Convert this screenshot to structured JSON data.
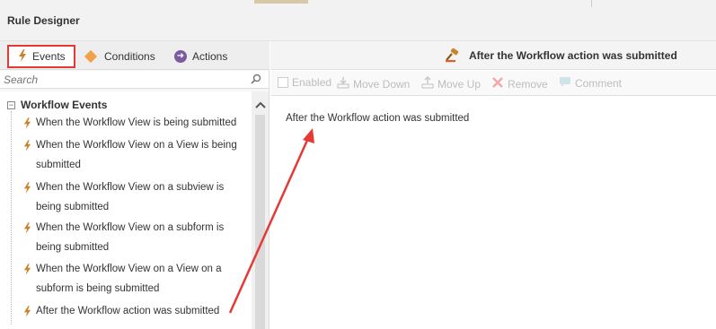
{
  "window": {
    "title": "Rule Designer"
  },
  "tabs": [
    {
      "label": "Events",
      "icon": "lightning-icon"
    },
    {
      "label": "Conditions",
      "icon": "diamond-icon"
    },
    {
      "label": "Actions",
      "icon": "arrow-circle-icon"
    }
  ],
  "search": {
    "placeholder": "Search"
  },
  "tree": {
    "group_label": "Workflow Events",
    "items": [
      {
        "line1": "When the Workflow View is being submitted",
        "line2": ""
      },
      {
        "line1": "When the Workflow View on a View is being",
        "line2": "submitted"
      },
      {
        "line1": "When the Workflow View on a subview is",
        "line2": "being submitted"
      },
      {
        "line1": "When the Workflow View on a subform is",
        "line2": "being submitted"
      },
      {
        "line1": "When the Workflow View on a View on a",
        "line2": "subform is being submitted"
      },
      {
        "line1": "After the Workflow action was submitted",
        "line2": ""
      }
    ]
  },
  "right_header": {
    "title": "After the Workflow action was submitted",
    "icon": "gavel-icon"
  },
  "toolbar": {
    "enabled_label": "Enabled",
    "move_down_label": "Move Down",
    "move_up_label": "Move Up",
    "remove_label": "Remove",
    "comment_label": "Comment"
  },
  "rule_text": "After the Workflow action was submitted",
  "colors": {
    "highlight_red": "#e53935",
    "event_bolt": "#c8842d",
    "condition_diamond": "#f0a24a",
    "action_purple": "#7b5a9d",
    "annotation_arrow": "#e53935"
  }
}
